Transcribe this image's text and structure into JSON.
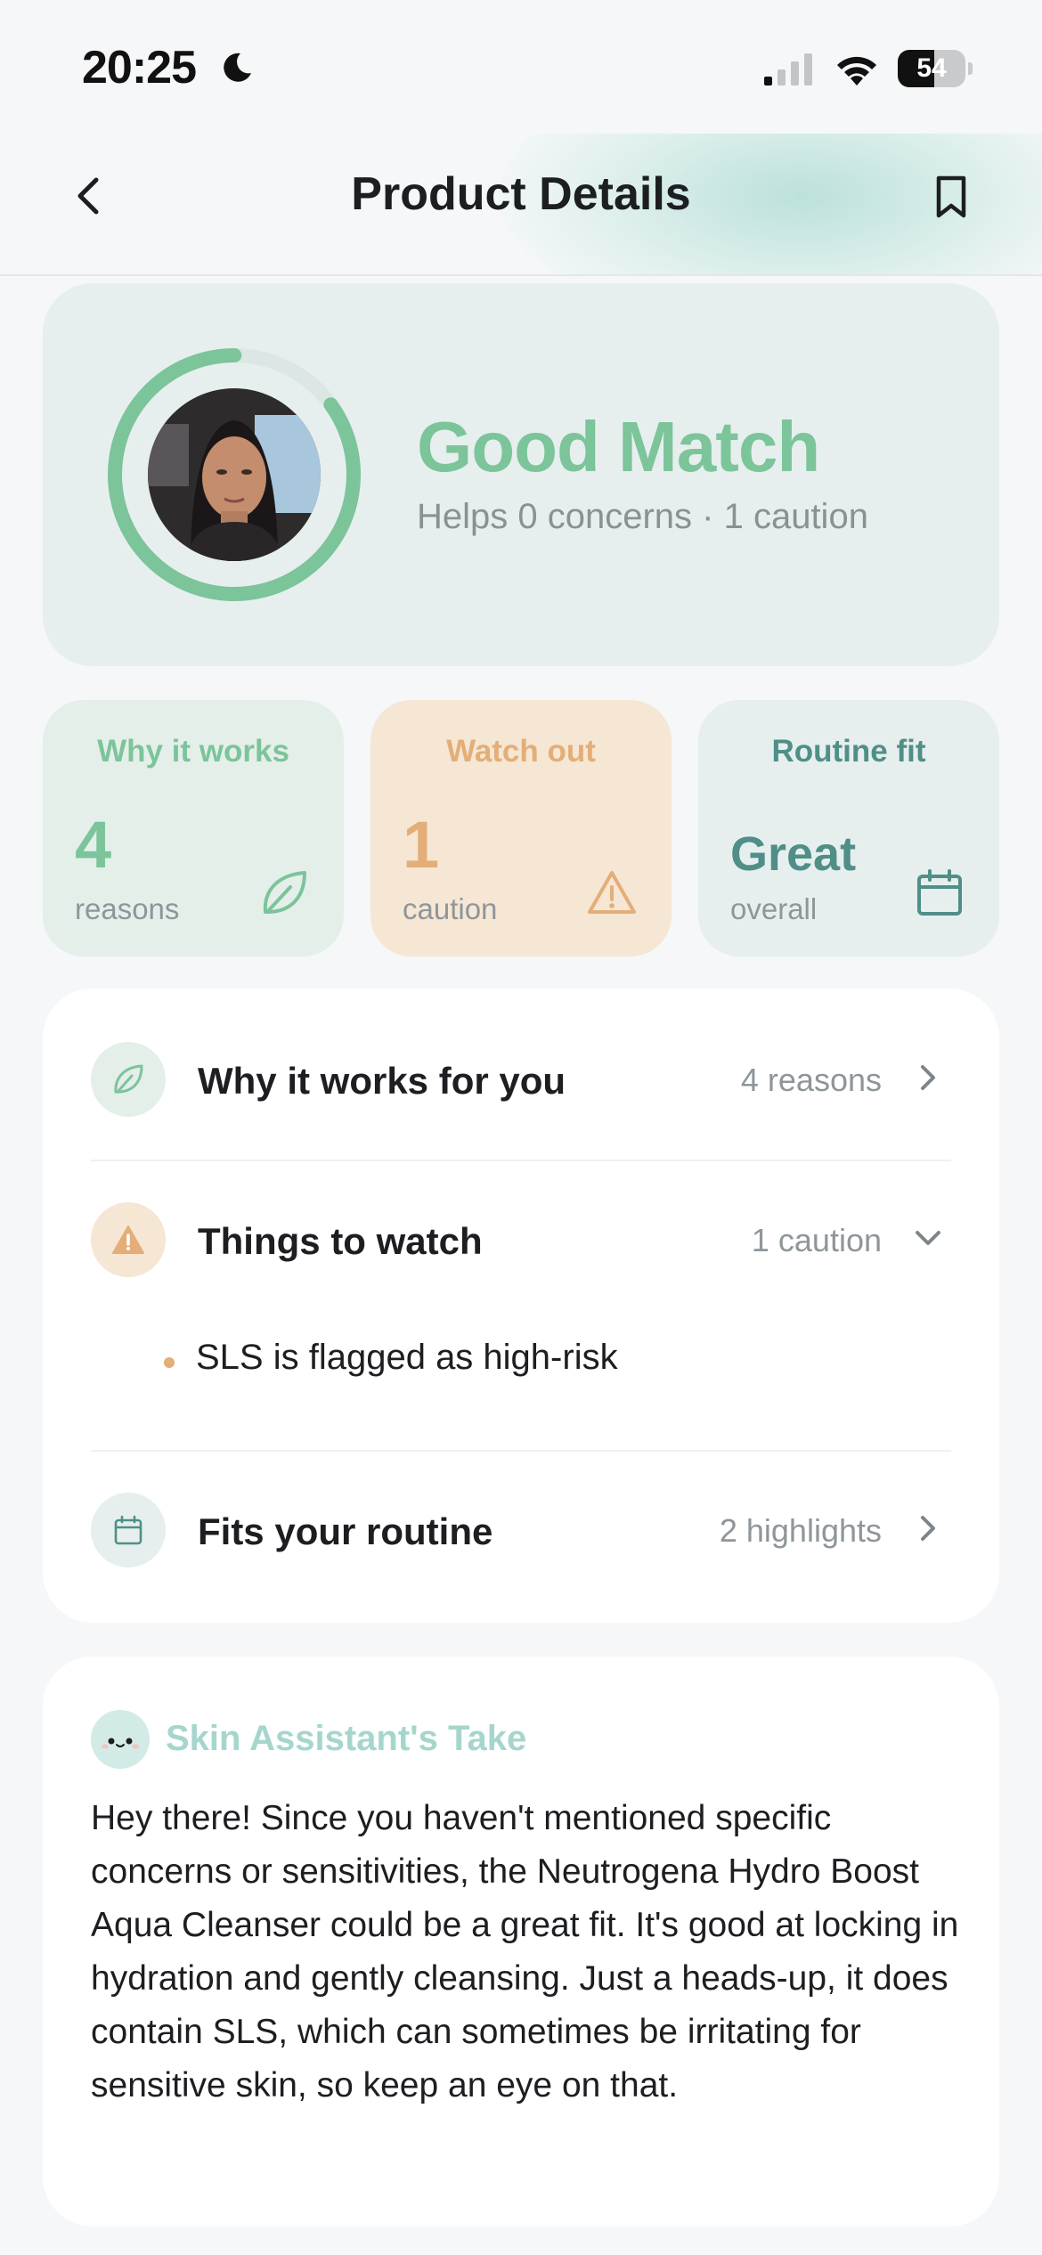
{
  "status_bar": {
    "time": "20:25",
    "battery": "54",
    "battery_level": 0.54
  },
  "header": {
    "title": "Product Details"
  },
  "match": {
    "title": "Good Match",
    "subtitle": "Helps 0 concerns · 1 caution",
    "ring_progress": 0.85,
    "accent": "#7cc49a"
  },
  "stats": {
    "why": {
      "label": "Why it works",
      "value": "4",
      "unit": "reasons",
      "icon": "leaf-icon"
    },
    "watch": {
      "label": "Watch out",
      "value": "1",
      "unit": "caution",
      "icon": "warning-icon"
    },
    "routine": {
      "label": "Routine fit",
      "value": "Great",
      "unit": "overall",
      "icon": "calendar-icon"
    }
  },
  "details": {
    "why": {
      "title": "Why it works for you",
      "meta": "4 reasons"
    },
    "watch": {
      "title": "Things to watch",
      "meta": "1 caution",
      "items": [
        "SLS is flagged as high-risk"
      ]
    },
    "routine": {
      "title": "Fits your routine",
      "meta": "2 highlights"
    }
  },
  "assistant": {
    "title": "Skin Assistant's Take",
    "text": "Hey there! Since you haven't mentioned specific concerns or sensitivities, the Neutrogena Hydro Boost Aqua Cleanser could be a great fit. It's good at locking in hydration and gently cleansing. Just a heads-up, it does contain SLS, which can sometimes be irritating for sensitive skin, so keep an eye on that."
  },
  "colors": {
    "green": "#7cc49a",
    "orange": "#e3ae78",
    "teal": "#4f8f88",
    "mint": "#a5d6cd"
  }
}
